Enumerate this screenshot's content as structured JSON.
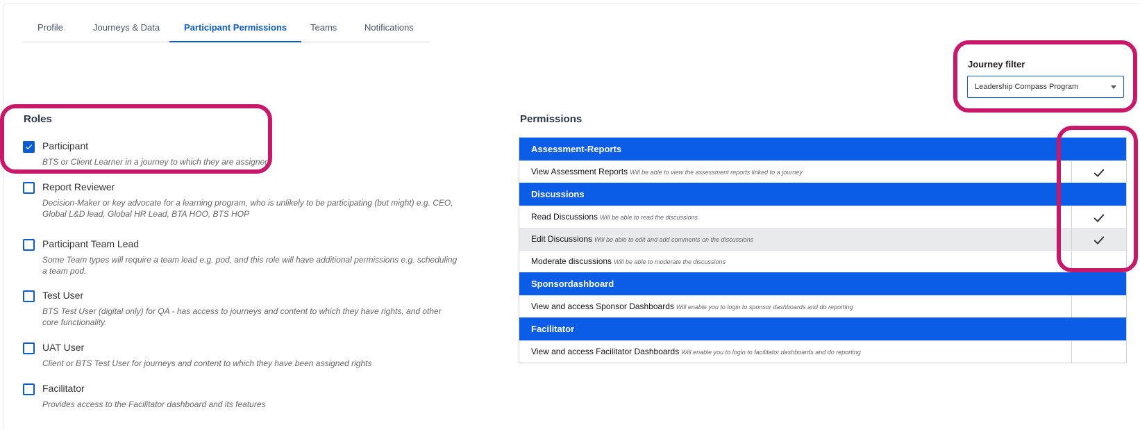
{
  "tabs": [
    {
      "label": "Profile"
    },
    {
      "label": "Journeys & Data"
    },
    {
      "label": "Participant Permissions",
      "active": true
    },
    {
      "label": "Teams"
    },
    {
      "label": "Notifications"
    }
  ],
  "journey_filter": {
    "label": "Journey filter",
    "selected": "Leadership Compass Program"
  },
  "roles": {
    "title": "Roles",
    "items": [
      {
        "name": "Participant",
        "checked": true,
        "desc": "BTS or Client Learner in a journey to which they are assigned"
      },
      {
        "name": "Report Reviewer",
        "checked": false,
        "desc": "Decision-Maker or key advocate for a learning program, who is unlikely to be participating (but might) e.g. CEO, Global L&D lead, Global HR Lead, BTA HOO, BTS HOP"
      },
      {
        "name": "Participant Team Lead",
        "checked": false,
        "desc": "Some Team types will require a team lead e.g. pod, and this role will have additional permissions e.g. scheduling a team pod."
      },
      {
        "name": "Test User",
        "checked": false,
        "desc": "BTS Test User (digital only) for QA - has access to journeys and content to which they have rights, and other core functionality."
      },
      {
        "name": "UAT User",
        "checked": false,
        "desc": "Client or BTS Test User for journeys and content to which they have been assigned rights"
      },
      {
        "name": "Facilitator",
        "checked": false,
        "desc": "Provides access to the Facilitator dashboard and its features"
      }
    ]
  },
  "permissions": {
    "title": "Permissions",
    "groups": [
      {
        "name": "Assessment-Reports",
        "rows": [
          {
            "name": "View Assessment Reports",
            "desc": "Will be able to view the assessment reports linked to a journey",
            "checked": true
          }
        ]
      },
      {
        "name": "Discussions",
        "rows": [
          {
            "name": "Read Discussions",
            "desc": "Will be able to read the discussions",
            "checked": true
          },
          {
            "name": "Edit Discussions",
            "desc": "Will be able to edit and add comments on the discussions",
            "checked": true
          },
          {
            "name": "Moderate discussions",
            "desc": "Will be able to moderate the discussions",
            "checked": false
          }
        ]
      },
      {
        "name": "Sponsordashboard",
        "rows": [
          {
            "name": "View and access Sponsor Dashboards",
            "desc": "Will enable you to login to sponsor dashboards and do reporting",
            "checked": false
          }
        ]
      },
      {
        "name": "Facilitator",
        "rows": [
          {
            "name": "View and access Facilitator Dashboards",
            "desc": "Will enable you to login to facilitator dashboards and do reporting",
            "checked": false
          }
        ]
      }
    ]
  },
  "colors": {
    "accent": "#0b5ce6",
    "annotation": "#c8186a"
  }
}
